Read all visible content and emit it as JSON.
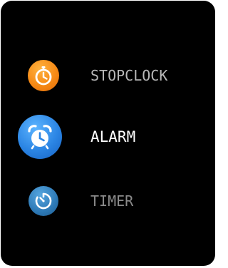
{
  "menu": {
    "items": [
      {
        "label": "STOPCLOCK",
        "icon": "stopwatch-icon",
        "color": "#f68a16",
        "state": "normal"
      },
      {
        "label": "ALARM",
        "icon": "alarm-clock-icon",
        "color": "#2b85e4",
        "state": "selected"
      },
      {
        "label": "TIMER",
        "icon": "timer-icon",
        "color": "#2d79b6",
        "state": "dimmed"
      }
    ]
  },
  "colors": {
    "screen_background": "#000000",
    "label_selected": "#ffffff",
    "label_normal": "#b9b9b9",
    "label_dimmed": "#8a8a8a"
  }
}
